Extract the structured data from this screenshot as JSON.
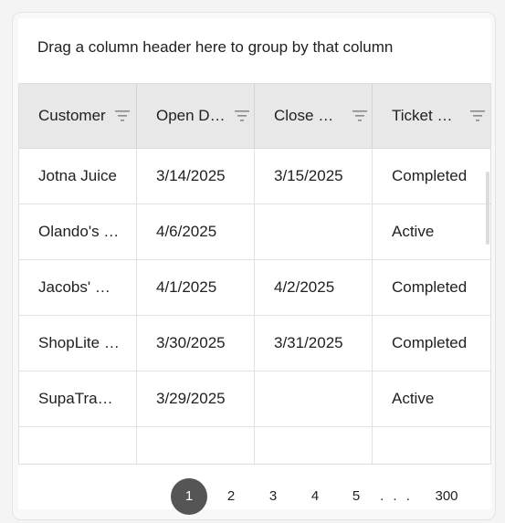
{
  "group_panel": {
    "hint": "Drag a column header here to group by that column"
  },
  "columns": [
    {
      "label": "Customer",
      "icon": "filter-icon"
    },
    {
      "label": "Open Date",
      "icon": "filter-icon"
    },
    {
      "label": "Close Date",
      "icon": "filter-icon"
    },
    {
      "label": "Ticket Status",
      "icon": "filter-icon"
    }
  ],
  "rows": [
    [
      "Jotna Juice",
      "3/14/2025",
      "3/15/2025",
      "Completed"
    ],
    [
      "Olando's Cafe",
      "4/6/2025",
      "",
      "Active"
    ],
    [
      "Jacobs' Store",
      "4/1/2025",
      "4/2/2025",
      "Completed"
    ],
    [
      "ShopLite Mart",
      "3/30/2025",
      "3/31/2025",
      "Completed"
    ],
    [
      "SupaTrade Co",
      "3/29/2025",
      "",
      "Active"
    ],
    [
      "",
      "",
      "",
      ""
    ]
  ],
  "pager": {
    "pages": [
      "1",
      "2",
      "3",
      "4",
      "5",
      ". . .",
      "300"
    ],
    "active_page": "1"
  },
  "colors": {
    "header_bg": "#e8e8e8",
    "active_page_bg": "#555555"
  }
}
